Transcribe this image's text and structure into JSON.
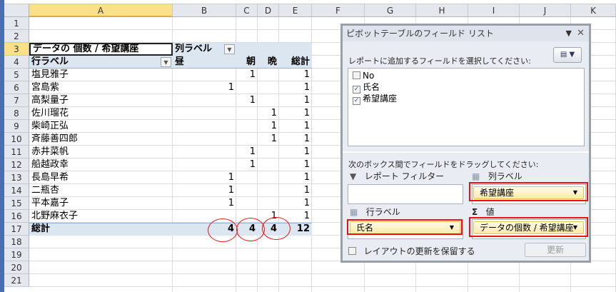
{
  "columns": [
    "A",
    "B",
    "C",
    "D",
    "E",
    "F",
    "G",
    "H",
    "I",
    "J",
    "K"
  ],
  "rows": [
    "1",
    "2",
    "3",
    "4",
    "5",
    "6",
    "7",
    "8",
    "9",
    "10",
    "11",
    "12",
    "13",
    "14",
    "15",
    "16",
    "17",
    "18",
    "19",
    "20",
    "21"
  ],
  "pivot": {
    "value_header": "データの 個数 / 希望講座",
    "col_label": "列ラベル",
    "row_label": "行ラベル",
    "col_headers": [
      "昼",
      "朝",
      "晩",
      "総計"
    ],
    "records": [
      {
        "name": "塩見雅子",
        "b": "",
        "c": "1",
        "d": "",
        "e": "1"
      },
      {
        "name": "宮島紫",
        "b": "1",
        "c": "",
        "d": "",
        "e": "1"
      },
      {
        "name": "高梨量子",
        "b": "",
        "c": "1",
        "d": "",
        "e": "1"
      },
      {
        "name": "佐川瑠花",
        "b": "",
        "c": "",
        "d": "1",
        "e": "1"
      },
      {
        "name": "柴崎正弘",
        "b": "",
        "c": "",
        "d": "1",
        "e": "1"
      },
      {
        "name": "斉藤善四郎",
        "b": "",
        "c": "",
        "d": "1",
        "e": "1"
      },
      {
        "name": "赤井菜帆",
        "b": "",
        "c": "1",
        "d": "",
        "e": "1"
      },
      {
        "name": "船越政幸",
        "b": "",
        "c": "1",
        "d": "",
        "e": "1"
      },
      {
        "name": "長島早希",
        "b": "1",
        "c": "",
        "d": "",
        "e": "1"
      },
      {
        "name": "二瓶杏",
        "b": "1",
        "c": "",
        "d": "",
        "e": "1"
      },
      {
        "name": "平本嘉子",
        "b": "1",
        "c": "",
        "d": "",
        "e": "1"
      },
      {
        "name": "北野麻衣子",
        "b": "",
        "c": "",
        "d": "1",
        "e": "1"
      }
    ],
    "total_label": "総計",
    "totals": [
      "4",
      "4",
      "4",
      "12"
    ]
  },
  "panel": {
    "title": "ピボットテーブルのフィールド リスト",
    "choose_label": "レポートに追加するフィールドを選択してください:",
    "fields": [
      {
        "label": "No",
        "checked": false
      },
      {
        "label": "氏名",
        "checked": true
      },
      {
        "label": "希望講座",
        "checked": true
      }
    ],
    "drag_label": "次のボックス間でフィールドをドラッグしてください:",
    "filter_label": "レポート フィルター",
    "col_area_label": "列ラベル",
    "row_area_label": "行ラベル",
    "values_area_label": "値",
    "col_field": "希望講座",
    "row_field": "氏名",
    "value_field": "データの個数 / 希望講座",
    "defer_label": "レイアウトの更新を保留する",
    "update_button": "更新"
  }
}
